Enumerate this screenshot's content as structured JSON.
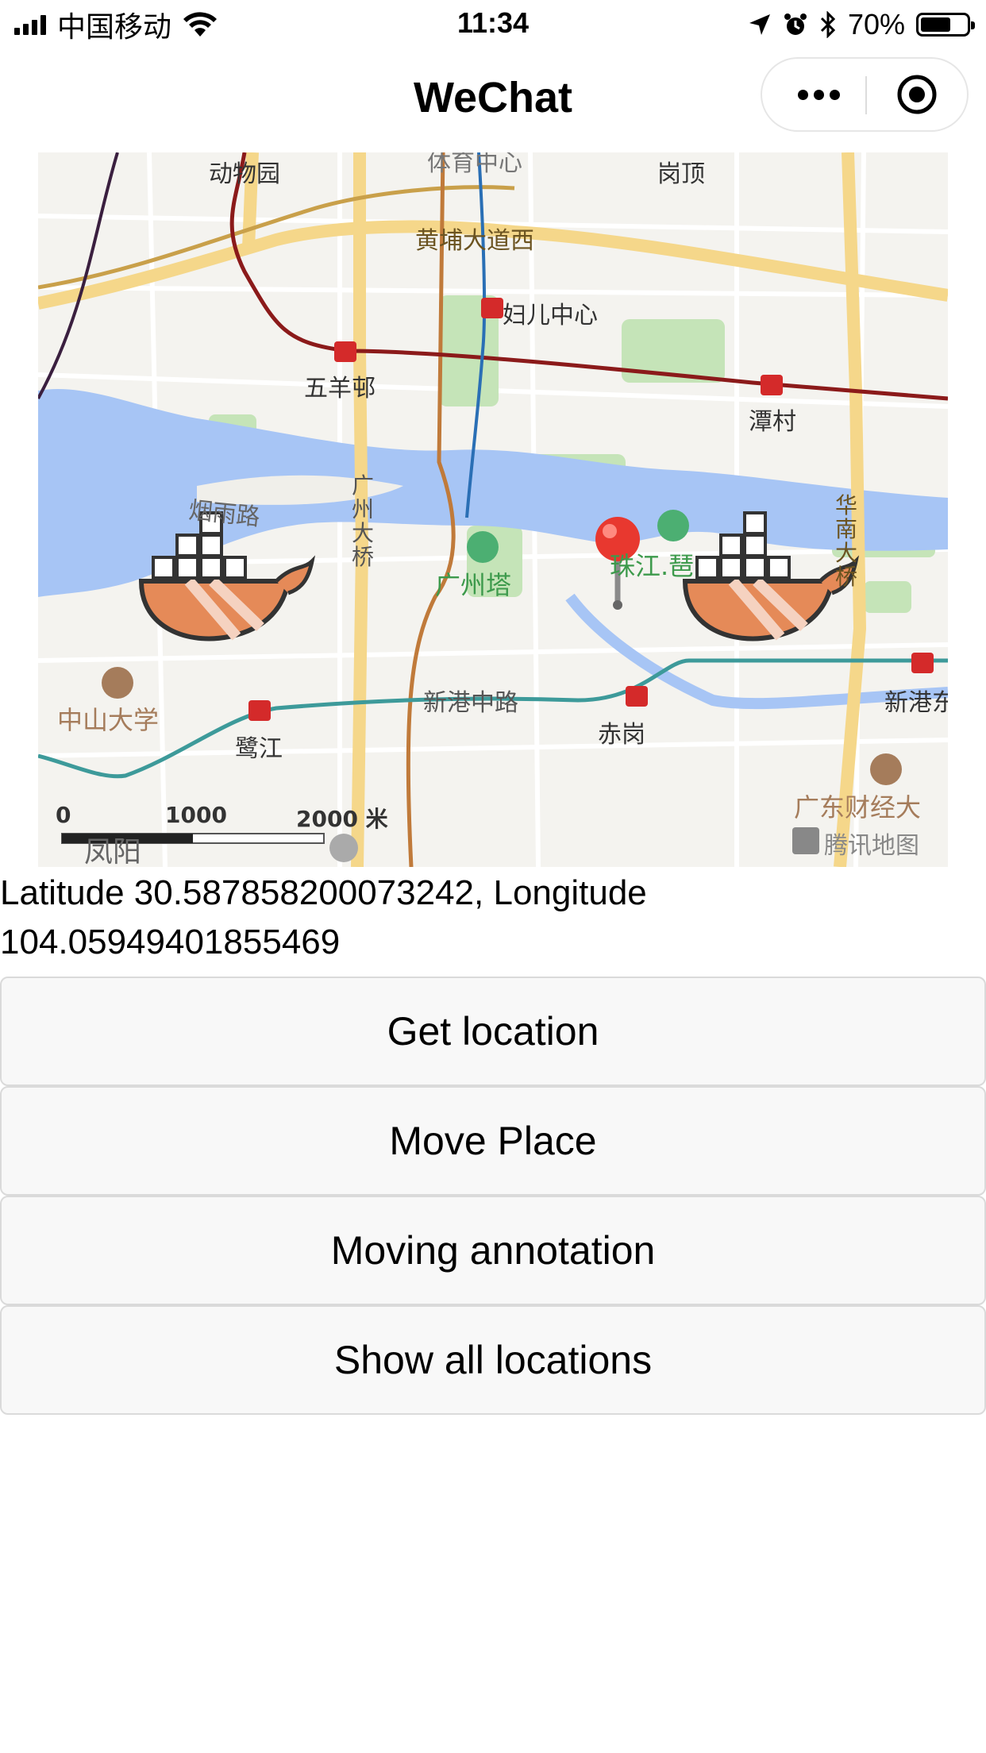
{
  "status_bar": {
    "carrier": "中国移动",
    "time": "11:34",
    "battery_text": "70%",
    "battery_level": 0.7
  },
  "nav": {
    "title": "WeChat",
    "more_icon": "more-dots-icon",
    "close_icon": "target-circle-icon"
  },
  "map": {
    "labels": {
      "zoo": "动物园",
      "sports": "体育中心",
      "gangding": "岗顶",
      "huangpu": "黄埔大道西",
      "fuer": "妇儿中心",
      "wuyang": "五羊邨",
      "tancun": "潭村",
      "yanyu": "烟雨路",
      "gz_bridge": "广州大桥",
      "canton_tower": "广州塔",
      "zhujiang": "珠江.琶",
      "huanan": "华南大桥",
      "zhongshan": "中山大学",
      "lujiang": "鹭江",
      "xingang": "新港中路",
      "chigang": "赤岗",
      "xingang_east": "新港东",
      "caijing": "广东财经大",
      "fengyang": "凤阳",
      "tencent_map": "腾讯地图"
    },
    "scale": {
      "tick0": "0",
      "tick1": "1000",
      "tick2": "2000 米"
    },
    "colors": {
      "river": "#a7c5f5",
      "park": "#c5e4b8",
      "metro_red": "#8b1a1a",
      "metro_teal": "#3d9a9a",
      "road_yellow": "#f5d78a",
      "pin": "#e8382f"
    }
  },
  "location_text": "Latitude 30.587858200073242, Longitude 104.05949401855469",
  "buttons": {
    "get_location": "Get location",
    "move_place": "Move Place",
    "moving_annotation": "Moving annotation",
    "show_all": "Show all locations"
  }
}
